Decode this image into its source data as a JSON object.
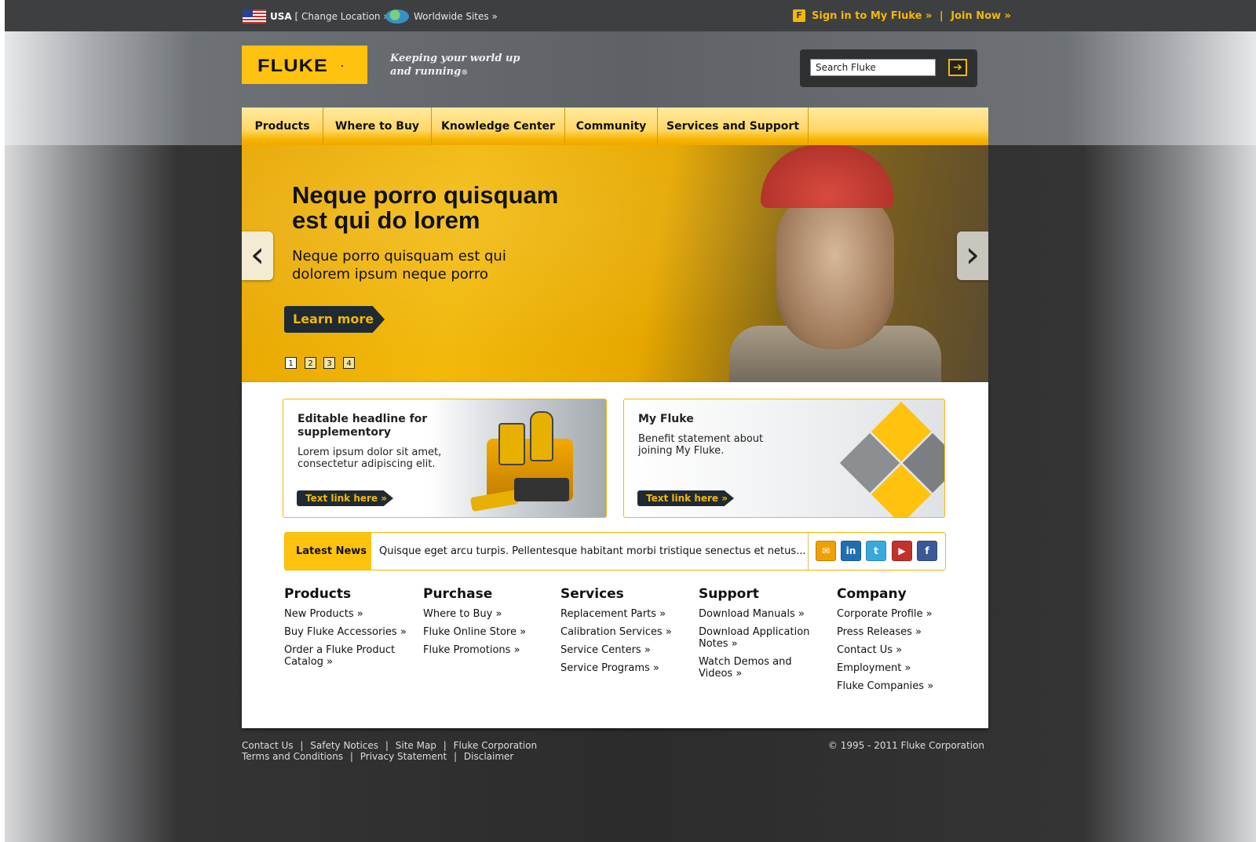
{
  "topbar": {
    "country": "USA",
    "change_location": "[ Change Location » ]",
    "worldwide": "Worldwide Sites »",
    "signin": "Sign in to My Fluke »",
    "separator": "|",
    "join": "Join Now »"
  },
  "header": {
    "logo": "FLUKE",
    "logo_mark": ".",
    "tagline_line1": "Keeping your world up",
    "tagline_line2": "and running",
    "tagline_reg": "®",
    "search_value": "Search Fluke"
  },
  "nav": [
    {
      "label": "Products"
    },
    {
      "label": "Where to Buy"
    },
    {
      "label": "Knowledge Center"
    },
    {
      "label": "Community"
    },
    {
      "label": "Services and Support"
    }
  ],
  "hero": {
    "headline_line1": "Neque porro quisquam",
    "headline_line2": "est qui do lorem",
    "sub_line1": "Neque porro quisquam est qui",
    "sub_line2": "dolorem ipsum neque porro",
    "cta": "Learn more »",
    "pages": [
      "1",
      "2",
      "3",
      "4"
    ],
    "active_page": 1,
    "prev_icon": "‹",
    "next_icon": "›"
  },
  "promos": [
    {
      "title_line1": "Editable headline for",
      "title_line2": "supplementory",
      "body_line1": "Lorem ipsum dolor sit amet,",
      "body_line2": "consectetur adipiscing elit.",
      "link": "Text link here »"
    },
    {
      "title_line1": "My Fluke",
      "body_line1": "Benefit statement about",
      "body_line2": "joining My Fluke.",
      "link": "Text link here »"
    }
  ],
  "news": {
    "label": "Latest News",
    "text": "Quisque eget arcu turpis. Pellentesque habitant morbi tristique senectus et netus...",
    "social": [
      {
        "icon": "email-icon",
        "glyph": "✉",
        "color": "#f0a000"
      },
      {
        "icon": "linkedin-icon",
        "glyph": "in",
        "color": "#1f6fb2"
      },
      {
        "icon": "twitter-icon",
        "glyph": "t",
        "color": "#39a9dc"
      },
      {
        "icon": "youtube-icon",
        "glyph": "▶",
        "color": "#c4302b"
      },
      {
        "icon": "facebook-icon",
        "glyph": "f",
        "color": "#3b5998"
      }
    ]
  },
  "columns": [
    {
      "heading": "Products",
      "links": [
        "New Products »",
        "Buy Fluke Accessories »",
        "Order a Fluke Product Catalog »"
      ]
    },
    {
      "heading": "Purchase",
      "links": [
        "Where to Buy »",
        "Fluke Online Store »",
        "Fluke Promotions »"
      ]
    },
    {
      "heading": "Services",
      "links": [
        "Replacement Parts »",
        "Calibration Services »",
        "Service Centers »",
        "Service Programs »"
      ]
    },
    {
      "heading": "Support",
      "links": [
        "Download Manuals »",
        "Download Application Notes »",
        "Watch Demos and Videos »"
      ]
    },
    {
      "heading": "Company",
      "links": [
        "Corporate Profile »",
        "Press Releases »",
        "Contact Us »",
        "Employment »",
        "Fluke Companies »"
      ]
    }
  ],
  "footer": {
    "row1": [
      "Contact Us",
      "Safety Notices",
      "Site Map",
      "Fluke Corporation"
    ],
    "row2": [
      "Terms and Conditions",
      "Privacy Statement",
      "Disclaimer"
    ],
    "separator": "|",
    "copyright": "© 1995 - 2011 Fluke Corporation"
  },
  "colors": {
    "brand_yellow": "#ffc20e",
    "dark": "#1f2a33",
    "link_yellow": "#f5b800"
  }
}
